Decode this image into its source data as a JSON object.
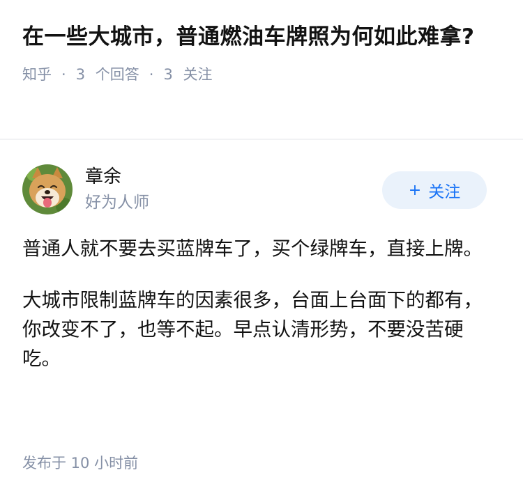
{
  "question": {
    "title": "在一些大城市，普通燃油车牌照为何如此难拿?",
    "source": "知乎",
    "answers_count": "3",
    "answers_label": "个回答",
    "followers_count": "3",
    "followers_label": "关注"
  },
  "answer": {
    "author": {
      "name": "章余",
      "bio": "好为人师",
      "avatar_icon": "shiba-dog-avatar"
    },
    "follow_button": {
      "icon": "+",
      "label": "关注"
    },
    "paragraphs": [
      "普通人就不要去买蓝牌车了，买个绿牌车，直接上牌。",
      "大城市限制蓝牌车的因素很多，台面上台面下的都有，你改变不了，也等不起。早点认清形势，不要没苦硬吃。"
    ],
    "published": "发布于  10 小时前"
  },
  "colors": {
    "accent": "#1772f6",
    "follow_bg": "#eaf2fb",
    "meta_gray": "#8590a6",
    "text": "#121212"
  }
}
